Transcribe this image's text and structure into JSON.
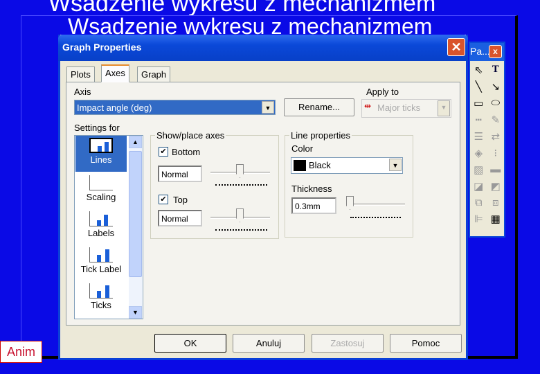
{
  "slide": {
    "title_back": "Wsadzenie wykresu z mechanizmem",
    "title_front": "Wsadzenie wykresu z mechanizmem",
    "anim_label": "Anim"
  },
  "dialog": {
    "title": "Graph Properties",
    "tabs": [
      {
        "label": "Plots"
      },
      {
        "label": "Axes",
        "active": true
      },
      {
        "label": "Graph"
      }
    ],
    "axis_label": "Axis",
    "axis_value": "Impact angle (deg)",
    "rename_label": "Rename...",
    "apply_to_label": "Apply to",
    "apply_to_value": "Major ticks",
    "settings_for_label": "Settings for",
    "settings_items": [
      {
        "label": "Lines",
        "selected": true
      },
      {
        "label": "Scaling"
      },
      {
        "label": "Labels"
      },
      {
        "label": "Tick Label"
      },
      {
        "label": "Ticks"
      }
    ],
    "show_place": {
      "title": "Show/place axes",
      "bottom_label": "Bottom",
      "bottom_checked": true,
      "bottom_value": "Normal",
      "top_label": "Top",
      "top_checked": true,
      "top_value": "Normal"
    },
    "line_props": {
      "title": "Line properties",
      "color_label": "Color",
      "color_value": "Black",
      "color_swatch": "#000000",
      "thickness_label": "Thickness",
      "thickness_value": "0.3mm"
    },
    "buttons": {
      "ok": "OK",
      "cancel": "Anuluj",
      "apply": "Zastosuj",
      "help": "Pomoc"
    }
  },
  "palette": {
    "title": "Pa...",
    "tools": [
      "pointer-icon",
      "text-icon",
      "line-icon",
      "arrow-icon",
      "rectangle-icon",
      "ellipse-icon"
    ]
  },
  "colors": {
    "background": "#0a0ae6",
    "titlebar": "#0a48d8",
    "dialog": "#ece9d8",
    "selection": "#316ac5"
  }
}
